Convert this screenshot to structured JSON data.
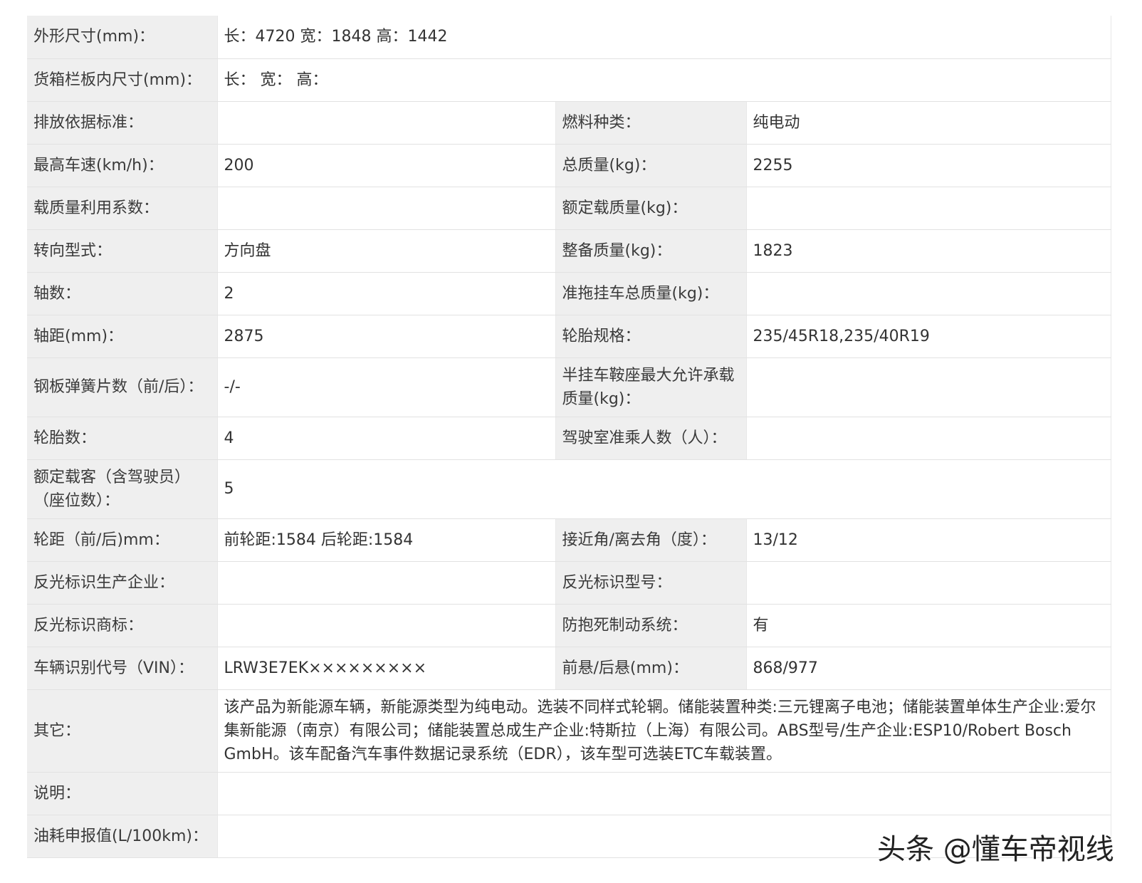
{
  "rows": [
    {
      "label": "外形尺寸(mm)：",
      "value": "长：4720 宽：1848 高：1442"
    },
    {
      "label": "货箱栏板内尺寸(mm)：",
      "value": "长： 宽： 高："
    },
    {
      "label": "排放依据标准：",
      "value": "",
      "label2": "燃料种类：",
      "value2": "纯电动"
    },
    {
      "label": "最高车速(km/h)：",
      "value": "200",
      "label2": "总质量(kg)：",
      "value2": "2255"
    },
    {
      "label": "载质量利用系数：",
      "value": "",
      "label2": "额定载质量(kg)：",
      "value2": ""
    },
    {
      "label": "转向型式：",
      "value": "方向盘",
      "label2": "整备质量(kg)：",
      "value2": "1823"
    },
    {
      "label": "轴数：",
      "value": "2",
      "label2": "准拖挂车总质量(kg)：",
      "value2": ""
    },
    {
      "label": "轴距(mm)：",
      "value": "2875",
      "label2": "轮胎规格：",
      "value2": "235/45R18,235/40R19"
    },
    {
      "label": "钢板弹簧片数（前/后）：",
      "value": "-/-",
      "label2": "半挂车鞍座最大允许承载质量(kg)：",
      "value2": ""
    },
    {
      "label": "轮胎数：",
      "value": "4",
      "label2": "驾驶室准乘人数（人）：",
      "value2": ""
    },
    {
      "label": "额定载客（含驾驶员）（座位数）：",
      "value": "5"
    },
    {
      "label": "轮距（前/后)mm：",
      "value": "前轮距:1584 后轮距:1584",
      "label2": "接近角/离去角（度）：",
      "value2": "13/12"
    },
    {
      "label": "反光标识生产企业：",
      "value": "",
      "label2": "反光标识型号：",
      "value2": ""
    },
    {
      "label": "反光标识商标：",
      "value": "",
      "label2": "防抱死制动系统：",
      "value2": "有"
    },
    {
      "label": "车辆识别代号（VIN）：",
      "value": "LRW3E7EK×××××××××",
      "label2": "前悬/后悬(mm)：",
      "value2": "868/977"
    },
    {
      "label": "其它：",
      "value": "该产品为新能源车辆，新能源类型为纯电动。选装不同样式轮辋。储能装置种类:三元锂离子电池；储能装置单体生产企业:爱尔集新能源（南京）有限公司；储能装置总成生产企业:特斯拉（上海）有限公司。ABS型号/生产企业:ESP10/Robert Bosch GmbH。该车配备汽车事件数据记录系统（EDR），该车型可选装ETC车载装置。"
    },
    {
      "label": "说明：",
      "value": ""
    },
    {
      "label": "油耗申报值(L/100km)：",
      "value": ""
    }
  ],
  "watermark": "头条 @懂车帝视线"
}
